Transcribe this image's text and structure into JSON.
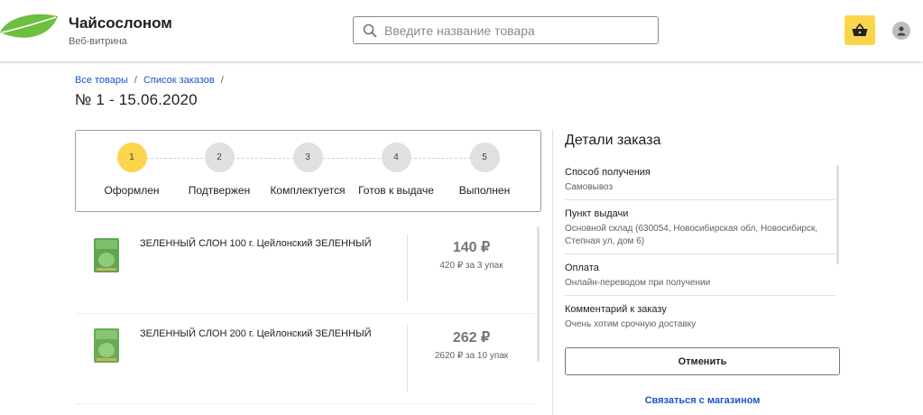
{
  "header": {
    "brand": "Чайсослоном",
    "subtitle": "Веб-витрина",
    "search_placeholder": "Введите название товара",
    "logo_icon": "leaf-icon",
    "cart_icon": "basket-icon",
    "profile_icon": "person-icon",
    "accent_color": "#fbd54c"
  },
  "breadcrumb": {
    "items": [
      "Все товары",
      "Список заказов"
    ],
    "separator": "/"
  },
  "order": {
    "title": "№ 1 - 15.06.2020"
  },
  "steps": [
    {
      "number": "1",
      "label": "Оформлен",
      "active": true
    },
    {
      "number": "2",
      "label": "Подтвержен",
      "active": false
    },
    {
      "number": "3",
      "label": "Комплектуется",
      "active": false
    },
    {
      "number": "4",
      "label": "Готов к выдаче",
      "active": false
    },
    {
      "number": "5",
      "label": "Выполнен",
      "active": false
    }
  ],
  "products": [
    {
      "name": "ЗЕЛЕННЫЙ СЛОН 100 г. Цейлонский ЗЕЛЕННЫЙ",
      "price": "140 ₽",
      "total": "420 ₽ за 3 упак"
    },
    {
      "name": "ЗЕЛЕННЫЙ СЛОН 200 г. Цейлонский ЗЕЛЕННЫЙ",
      "price": "262 ₽",
      "total": "2620 ₽ за 10 упак"
    }
  ],
  "details": {
    "title": "Детали заказа",
    "items": [
      {
        "label": "Способ получения",
        "value": "Самовывоз"
      },
      {
        "label": "Пункт выдачи",
        "value": "Основной склад (630054, Новосибирская обл, Новосибирск, Степная ул, дом 6)"
      },
      {
        "label": "Оплата",
        "value": "Онлайн-переводом при получении"
      },
      {
        "label": "Комментарий к заказу",
        "value": "Очень хотим срочную доставку"
      }
    ]
  },
  "actions": {
    "cancel_label": "Отменить",
    "contact_label": "Связаться с магазином"
  }
}
